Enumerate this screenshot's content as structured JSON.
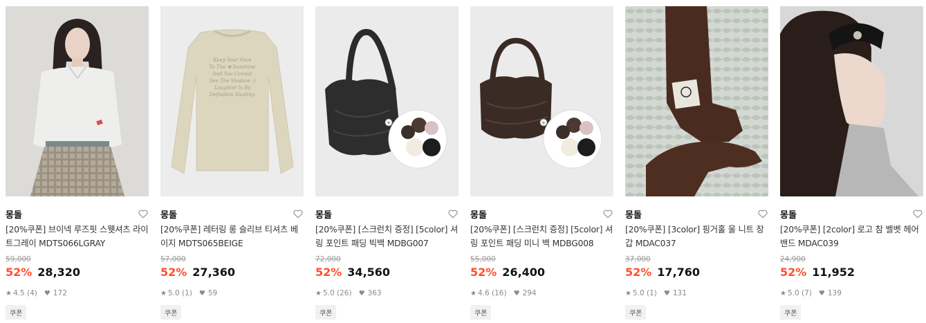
{
  "products": [
    {
      "brand": "몽돌",
      "title": "[20%쿠폰] 브이넥 루즈핏 스웻셔츠 라이트그레이 MDTS066LGRAY",
      "original_price": "59,000",
      "discount": "52%",
      "price": "28,320",
      "rating": "4.5 (4)",
      "likes": "172",
      "badge": "쿠폰",
      "image": "model-light-gray-sweatshirt"
    },
    {
      "brand": "몽돌",
      "title": "[20%쿠폰] 레터링 롱 슬리브 티셔츠 베이지 MDTS065BEIGE",
      "original_price": "57,000",
      "discount": "52%",
      "price": "27,360",
      "rating": "5.0 (1)",
      "likes": "59",
      "badge": "쿠폰",
      "image": "beige-long-sleeve-tee",
      "print_lines": [
        "Keep Your Face",
        "To The ❀ Sunshine",
        "And You Cannot",
        "See The Shadow :)",
        "Laughter Is By",
        "Definition Healthy."
      ]
    },
    {
      "brand": "몽돌",
      "title": "[20%쿠폰] [스크런치 증정] [5color] 셔링 포인트 패딩 빅백 MDBG007",
      "original_price": "72,000",
      "discount": "52%",
      "price": "34,560",
      "rating": "5.0 (26)",
      "likes": "363",
      "badge": "쿠폰",
      "image": "black-padded-big-bag-with-scrunchies"
    },
    {
      "brand": "몽돌",
      "title": "[20%쿠폰] [스크런치 증정] [5color] 셔링 포인트 패딩 미니 백 MDBG008",
      "original_price": "55,000",
      "discount": "52%",
      "price": "26,400",
      "rating": "4.6 (16)",
      "likes": "294",
      "badge": "쿠폰",
      "image": "brown-padded-mini-bag-with-scrunchies"
    },
    {
      "brand": "몽돌",
      "title": "[20%쿠폰] [3color] 핑거홀 울 니트 장갑 MDAC037",
      "original_price": "37,000",
      "discount": "52%",
      "price": "17,760",
      "rating": "5.0 (1)",
      "likes": "131",
      "badge": "쿠폰",
      "image": "brown-knit-gloves"
    },
    {
      "brand": "몽돌",
      "title": "[20%쿠폰] [2color] 로고 참 벨벳 헤어밴드 MDAC039",
      "original_price": "24,900",
      "discount": "52%",
      "price": "11,952",
      "rating": "5.0 (7)",
      "likes": "139",
      "badge": "쿠폰",
      "image": "black-velvet-headband"
    }
  ],
  "colors": {
    "discount": "#ff4e2b",
    "text": "#111111",
    "muted": "#9a9a9a",
    "badge_bg": "#f1f1f1"
  },
  "icons": {
    "wishlist": "heart-outline-icon",
    "rating": "star-icon",
    "likes": "heart-icon"
  }
}
